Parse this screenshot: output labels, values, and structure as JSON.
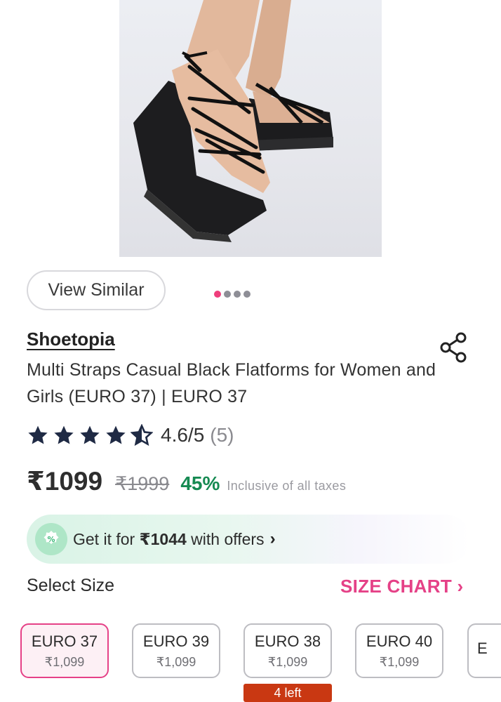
{
  "product": {
    "brand": "Shoetopia",
    "title": "Multi Straps Casual Black Flatforms for Women and Girls (EURO 37) | EURO 37",
    "image_slides": 4,
    "active_slide": 1
  },
  "actions": {
    "view_similar": "View Similar",
    "share_icon": "share-icon"
  },
  "rating": {
    "stars": 4.5,
    "value": "4.6/5",
    "count": "(5)"
  },
  "pricing": {
    "price": "₹1099",
    "mrp": "₹1999",
    "discount": "45%",
    "tax_note": "Inclusive of all taxes"
  },
  "offer": {
    "prefix": "Get it for ",
    "amount": "₹1044",
    "suffix": " with offers"
  },
  "size": {
    "heading": "Select Size",
    "chart_link": "SIZE CHART",
    "options": [
      {
        "label": "EURO 37",
        "price": "₹1,099",
        "selected": true
      },
      {
        "label": "EURO 39",
        "price": "₹1,099",
        "selected": false
      },
      {
        "label": "EURO 38",
        "price": "₹1,099",
        "selected": false,
        "badge": "4 left"
      },
      {
        "label": "EURO 40",
        "price": "₹1,099",
        "selected": false
      },
      {
        "label": "E",
        "price": "",
        "selected": false
      }
    ]
  },
  "colors": {
    "accent": "#e54187",
    "discount": "#168a52",
    "stock_badge": "#c93812"
  }
}
